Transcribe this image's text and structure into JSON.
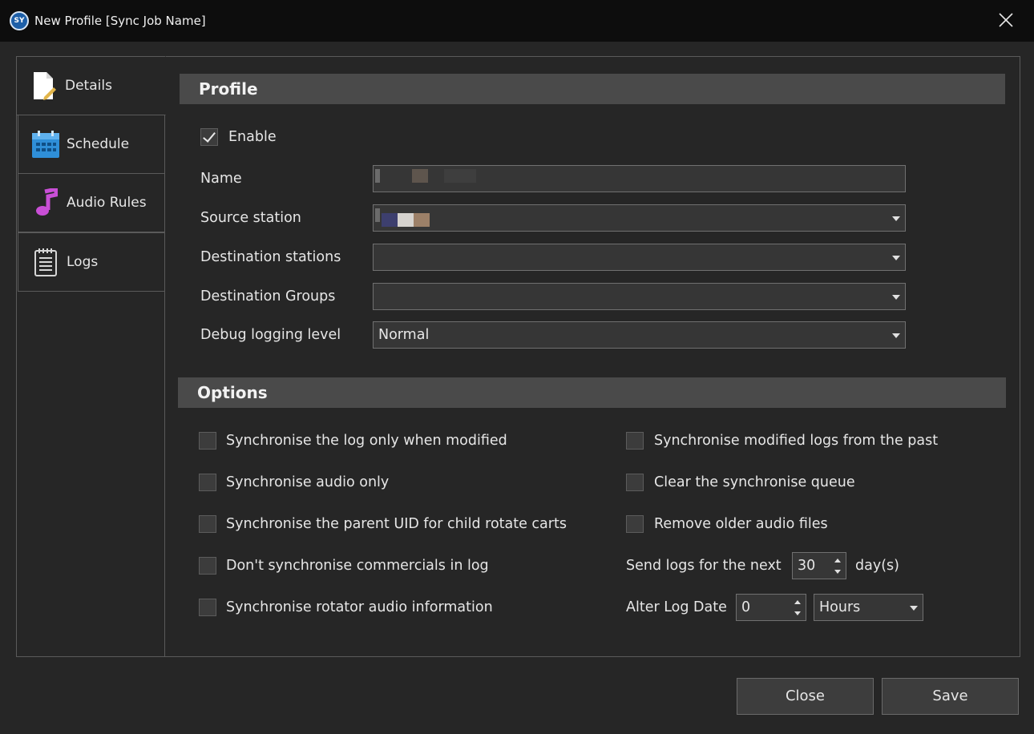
{
  "window": {
    "logo_text": "SY",
    "title": "New Profile [Sync Job Name]",
    "close_icon": "close-icon"
  },
  "tabs": [
    {
      "label": "Details",
      "icon": "document-edit-icon",
      "active": true
    },
    {
      "label": "Schedule",
      "icon": "calendar-icon",
      "active": false
    },
    {
      "label": "Audio Rules",
      "icon": "music-note-icon",
      "active": false
    },
    {
      "label": "Logs",
      "icon": "notepad-icon",
      "active": false
    }
  ],
  "profile": {
    "header": "Profile",
    "enable_label": "Enable",
    "enable_checked": true,
    "name_label": "Name",
    "name_value": "",
    "source_station_label": "Source station",
    "source_station_value": "",
    "destination_stations_label": "Destination stations",
    "destination_stations_value": "",
    "destination_groups_label": "Destination Groups",
    "destination_groups_value": "",
    "debug_logging_label": "Debug logging level",
    "debug_logging_value": "Normal"
  },
  "options": {
    "header": "Options",
    "left": [
      {
        "label": "Synchronise the log only when modified",
        "checked": false
      },
      {
        "label": "Synchronise audio only",
        "checked": false
      },
      {
        "label": "Synchronise the parent UID for child rotate carts",
        "checked": false
      },
      {
        "label": "Don't synchronise commercials in log",
        "checked": false
      },
      {
        "label": "Synchronise rotator audio information",
        "checked": false
      }
    ],
    "right": [
      {
        "label": "Synchronise modified logs from the past",
        "checked": false
      },
      {
        "label": "Clear the synchronise queue",
        "checked": false
      },
      {
        "label": "Remove older audio files",
        "checked": false
      }
    ],
    "send_logs_label": "Send logs for the next",
    "send_logs_value": "30",
    "send_logs_unit": "day(s)",
    "alter_log_label": "Alter Log Date",
    "alter_log_value": "0",
    "alter_log_unit": "Hours"
  },
  "buttons": {
    "close": "Close",
    "save": "Save"
  },
  "colors": {
    "background": "#262626",
    "titlebar": "#0d0d0d",
    "section_header": "#4a4a4a",
    "field": "#363636"
  }
}
